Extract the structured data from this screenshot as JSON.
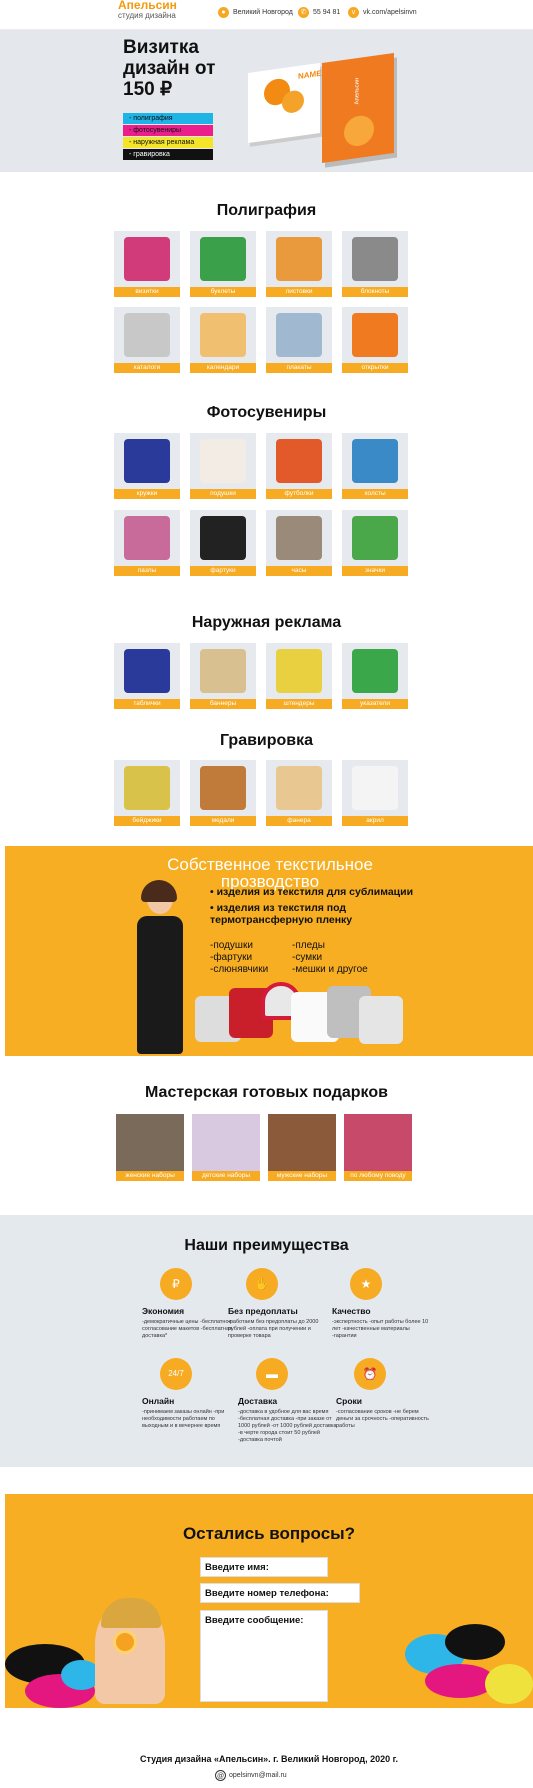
{
  "header": {
    "logo": "Апельсин",
    "logo_sub": "студия дизайна",
    "city": "Великий Новгород",
    "phone": "55 94 81",
    "social": "vk.com/apelsinvn",
    "icons": [
      "map-pin-icon",
      "phone-icon",
      "vk-icon"
    ]
  },
  "hero": {
    "title": "Визитка дизайн от 150 ₽",
    "card_text": "NAME",
    "card_back": "Апельсин",
    "tags": [
      {
        "label": "- полиграфия",
        "color": "#1eb4e6"
      },
      {
        "label": "- фотосувениры",
        "color": "#ea1f8c"
      },
      {
        "label": "- наружная реклама",
        "color": "#f5e52a"
      },
      {
        "label": "- гравировка",
        "color": "#111111"
      }
    ]
  },
  "poligrafia": {
    "title": "Полиграфия",
    "items": [
      "визитки",
      "буклеты",
      "листовки",
      "блокноты",
      "каталоги",
      "календари",
      "плакаты",
      "открытки"
    ]
  },
  "fotosuveniry": {
    "title": "Фотосувениры",
    "items": [
      "кружки",
      "подушки",
      "футболки",
      "холсты",
      "пазлы",
      "фартуки",
      "часы",
      "значки"
    ]
  },
  "reklama": {
    "title": "Наружная реклама",
    "items": [
      "таблички",
      "баннеры",
      "штендеры",
      "указатели"
    ]
  },
  "gravirovka": {
    "title": "Гравировка",
    "items": [
      "бейджики",
      "медали",
      "фанера",
      "акрил"
    ]
  },
  "textile": {
    "title": "Собственное текстильное прозводство",
    "bullets": [
      "• изделия из текстиля для сублимации",
      "• изделия из текстиля под термотрансферную пленку"
    ],
    "left_list": [
      "-подушки",
      "-фартуки",
      "-слюнявчики"
    ],
    "right_list": [
      "-пледы",
      "-сумки",
      "-мешки и другое"
    ]
  },
  "gifts": {
    "title": "Мастерская готовых подарков",
    "items": [
      "женские наборы",
      "детские наборы",
      "мужские наборы",
      "по любому поводу"
    ]
  },
  "advantages": {
    "title": "Наши преимущества",
    "items": [
      {
        "title": "Экономия",
        "icon": "wallet-icon",
        "text": "-демократичные цены -бесплатное согласование макетов -бесплатная доставка*"
      },
      {
        "title": "Без предоплаты",
        "icon": "hand-coin-icon",
        "text": "-работаем без предоплаты до 2000 рублей -оплата при получении и проверке товара"
      },
      {
        "title": "Качество",
        "icon": "medal-icon",
        "text": "-экспертность -опыт работы более 10 лет -качественные материалы -гарантии"
      },
      {
        "title": "Онлайн",
        "icon": "24-7-icon",
        "text": "-принимаем заказы онлайн -при необходимости работаем по выходным и в вечернее время"
      },
      {
        "title": "Доставка",
        "icon": "truck-icon",
        "text": "-доставка в удобное для вас время -бесплатная доставка -при заказе от 1000 рублей -от 1000 рублей доставка -в черте города стоит 50 рублей -доставка почтой"
      },
      {
        "title": "Сроки",
        "icon": "alarm-clock-icon",
        "text": "-согласование сроков -не берем деньги за срочность -оперативность работы"
      }
    ]
  },
  "form": {
    "title": "Остались вопросы?",
    "name_placeholder": "Введите имя:",
    "phone_placeholder": "Введите номер телефона:",
    "message_placeholder": "Введите сообщение:"
  },
  "footer": {
    "text": "Студия дизайна «Апельсин». г. Великий Новгород, 2020 г.",
    "email": "opelsinvn@mail.ru"
  },
  "colors": {
    "accent": "#f7ab23",
    "hero_bg": "#e4e8ec",
    "tile_bg": "#e6eaee"
  }
}
